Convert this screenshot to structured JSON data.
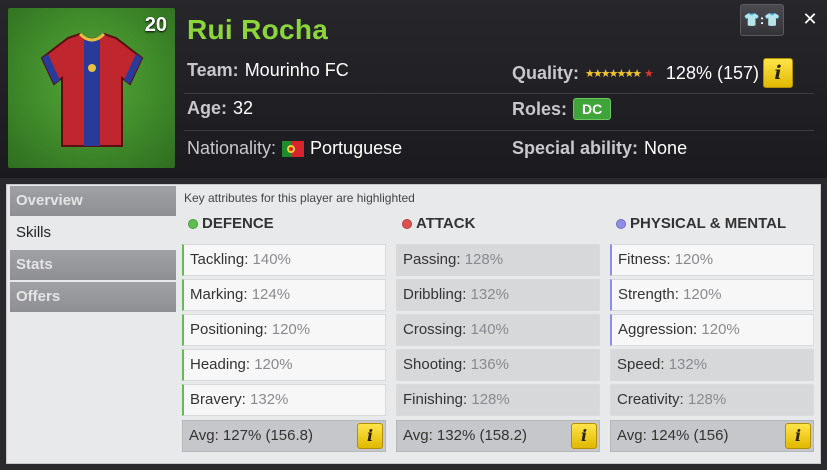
{
  "player": {
    "number": "20",
    "name": "Rui Rocha",
    "team_label": "Team:",
    "team": "Mourinho FC",
    "age_label": "Age:",
    "age": "32",
    "nationality_label": "Nationality:",
    "nationality": "Portuguese",
    "quality_label": "Quality:",
    "quality_value": "128% (157)",
    "roles_label": "Roles:",
    "role": "DC",
    "special_label": "Special ability:",
    "special": "None"
  },
  "buttons": {
    "kit": "👕:👕",
    "close": "✕",
    "info": "i"
  },
  "colors": {
    "accent": "#8cd63a",
    "defence": "#5cc14a",
    "attack": "#e0514e",
    "physical": "#8c8fe8"
  },
  "tabs": [
    "Overview",
    "Skills",
    "Stats",
    "Offers"
  ],
  "active_tab": "Skills",
  "hint": "Key attributes for this player are highlighted",
  "columns": [
    {
      "title": "DEFENCE",
      "attrs": [
        {
          "label": "Tackling:",
          "value": "140%"
        },
        {
          "label": "Marking:",
          "value": "124%"
        },
        {
          "label": "Positioning:",
          "value": "120%"
        },
        {
          "label": "Heading:",
          "value": "120%"
        },
        {
          "label": "Bravery:",
          "value": "132%"
        }
      ],
      "avg": "Avg: 127% (156.8)"
    },
    {
      "title": "ATTACK",
      "attrs": [
        {
          "label": "Passing:",
          "value": "128%"
        },
        {
          "label": "Dribbling:",
          "value": "132%"
        },
        {
          "label": "Crossing:",
          "value": "140%"
        },
        {
          "label": "Shooting:",
          "value": "136%"
        },
        {
          "label": "Finishing:",
          "value": "128%"
        }
      ],
      "avg": "Avg: 132% (158.2)"
    },
    {
      "title": "PHYSICAL & MENTAL",
      "attrs": [
        {
          "label": "Fitness:",
          "value": "120%"
        },
        {
          "label": "Strength:",
          "value": "120%"
        },
        {
          "label": "Aggression:",
          "value": "120%"
        },
        {
          "label": "Speed:",
          "value": "132%"
        },
        {
          "label": "Creativity:",
          "value": "128%"
        }
      ],
      "avg": "Avg: 124% (156)"
    }
  ]
}
